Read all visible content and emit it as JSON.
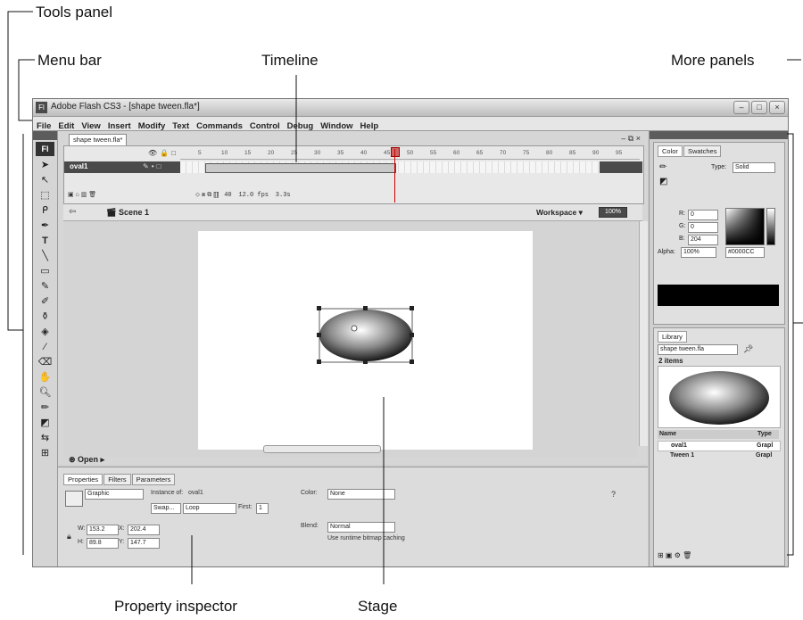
{
  "callouts": {
    "tools_panel": "Tools panel",
    "menu_bar": "Menu bar",
    "timeline": "Timeline",
    "more_panels": "More panels",
    "property_inspector": "Property inspector",
    "stage": "Stage"
  },
  "window": {
    "title": "Adobe Flash CS3 - [shape tween.fla*]",
    "app_icon": "Fl",
    "controls": [
      "–",
      "□",
      "×"
    ]
  },
  "menu": [
    "File",
    "Edit",
    "View",
    "Insert",
    "Modify",
    "Text",
    "Commands",
    "Control",
    "Debug",
    "Window",
    "Help"
  ],
  "tools": {
    "logo": "Fl",
    "items": [
      "selection-tool",
      "subselection-tool",
      "free-transform-tool",
      "lasso-tool",
      "pen-tool",
      "text-tool",
      "line-tool",
      "rectangle-tool",
      "pencil-tool",
      "brush-tool",
      "ink-bottle-tool",
      "paint-bucket-tool",
      "eyedropper-tool",
      "eraser-tool",
      "hand-tool",
      "zoom-tool",
      "stroke-color",
      "fill-color",
      "swap-colors",
      "snap-option"
    ]
  },
  "document": {
    "tab": "shape tween.fla*",
    "timeline": {
      "ruler": [
        "5",
        "10",
        "15",
        "20",
        "25",
        "30",
        "35",
        "40",
        "45",
        "50",
        "55",
        "60",
        "65",
        "70",
        "75",
        "80",
        "85",
        "90",
        "95"
      ],
      "layer_name": "oval1",
      "current_frame": "40",
      "fps": "12.0 fps",
      "time": "3.3s"
    },
    "edit_bar": {
      "scene": "Scene 1",
      "workspace": "Workspace",
      "zoom": "100%"
    },
    "open_label": "Open"
  },
  "properties": {
    "tabs": [
      "Properties",
      "Filters",
      "Parameters"
    ],
    "symbol_type": "Graphic",
    "instance_of_label": "Instance of:",
    "instance_of": "oval1",
    "swap_label": "Swap...",
    "loop": "Loop",
    "first_label": "First:",
    "first": "1",
    "color_label": "Color:",
    "color": "None",
    "blend_label": "Blend:",
    "blend": "Normal",
    "cache_label": "Use runtime bitmap caching",
    "w_label": "W:",
    "w": "153.2",
    "x_label": "X:",
    "x": "202.4",
    "h_label": "H:",
    "h": "89.8",
    "y_label": "Y:",
    "y": "147.7"
  },
  "color_panel": {
    "tabs": [
      "Color",
      "Swatches"
    ],
    "type_label": "Type:",
    "type": "Solid",
    "r_label": "R:",
    "r": "0",
    "g_label": "G:",
    "g": "0",
    "b_label": "B:",
    "b": "204",
    "alpha_label": "Alpha:",
    "alpha": "100%",
    "hex": "#0000CC"
  },
  "library": {
    "tab": "Library",
    "file": "shape tween.fla",
    "count": "2 items",
    "columns": [
      "Name",
      "Type"
    ],
    "items": [
      {
        "name": "oval1",
        "type": "Grapl"
      },
      {
        "name": "Tween 1",
        "type": "Grapl"
      }
    ]
  }
}
